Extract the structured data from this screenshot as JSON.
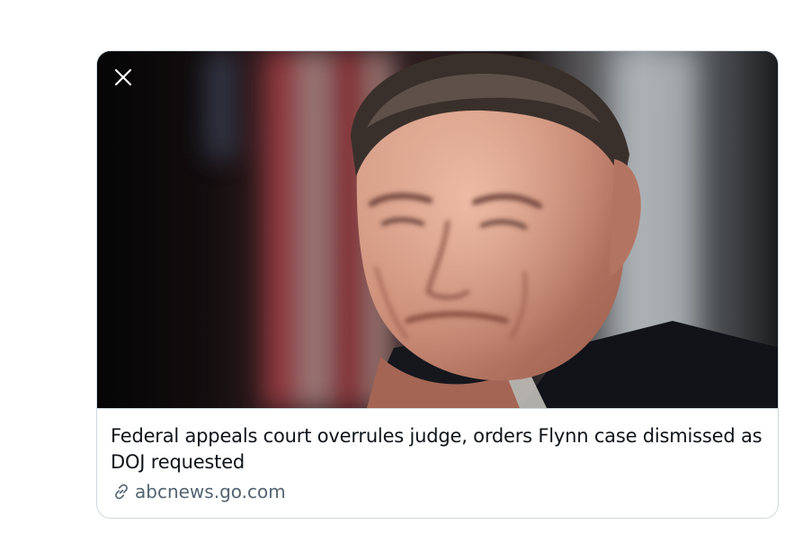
{
  "card": {
    "headline": "Federal appeals court overrules judge, orders Flynn case dismissed as DOJ requested",
    "domain": "abcnews.go.com",
    "close_icon": "close-icon",
    "link_icon": "link-icon"
  },
  "colors": {
    "text_primary": "#0f1419",
    "text_secondary": "#536471",
    "border": "#cfd9de"
  }
}
